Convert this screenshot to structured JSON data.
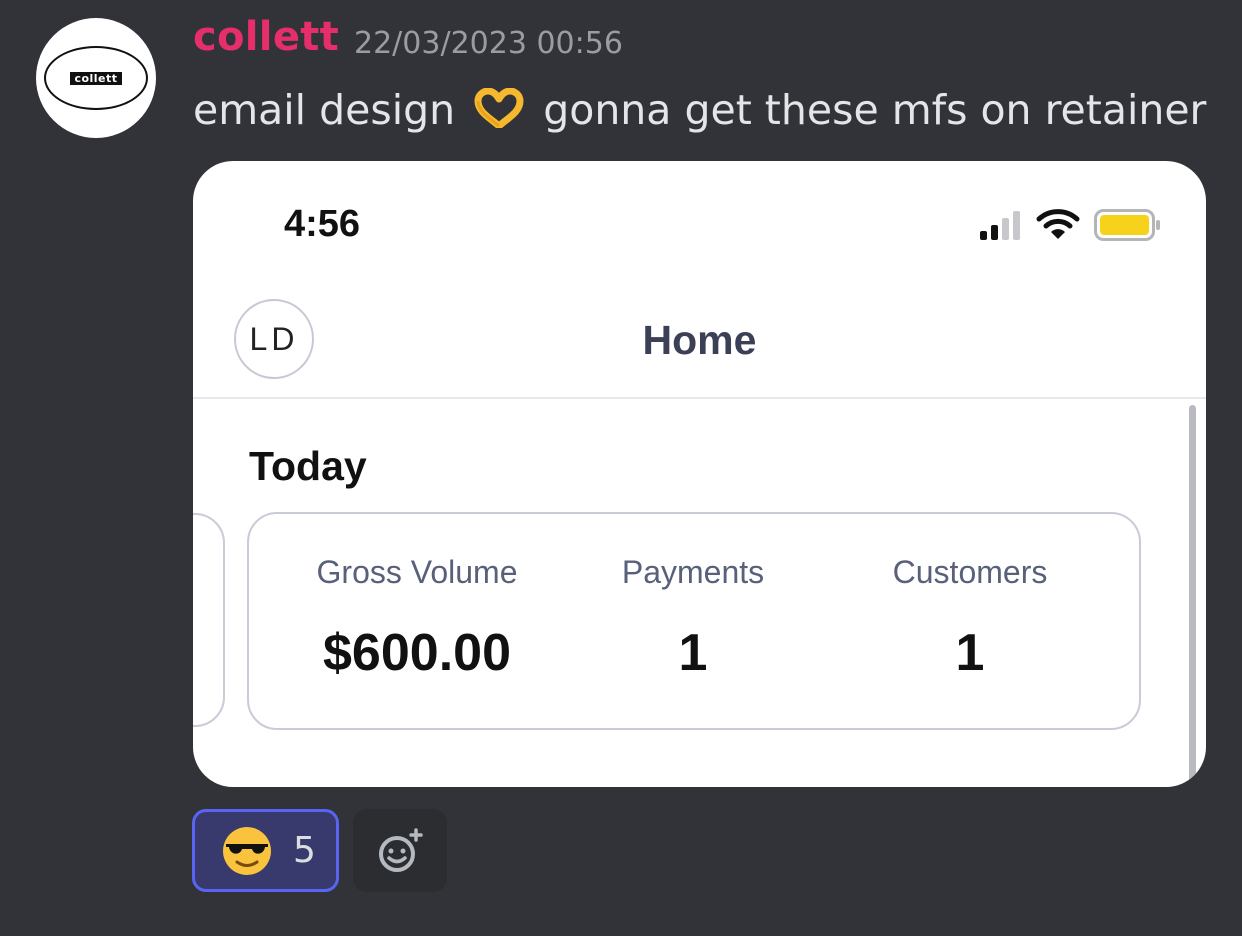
{
  "message": {
    "author": "collett",
    "avatar_text": "collett",
    "timestamp": "22/03/2023 00:56",
    "text_before": "email design ",
    "emoji": "heart-hands",
    "text_after": " gonna get these mfs on retainer",
    "author_color": "#e62e6b"
  },
  "attachment": {
    "status_time": "4:56",
    "profile_initials": "LD",
    "nav_title": "Home",
    "section_title": "Today",
    "stats": [
      {
        "label": "Gross Volume",
        "value": "$600.00"
      },
      {
        "label": "Payments",
        "value": "1"
      },
      {
        "label": "Customers",
        "value": "1"
      }
    ],
    "battery_color": "#f7d21b"
  },
  "reactions": [
    {
      "emoji": "smiling-face-with-sunglasses",
      "count": "5",
      "selected": true
    }
  ],
  "add_reaction": {
    "icon": "add-reaction-icon"
  },
  "colors": {
    "background": "#313338",
    "reaction_selected_border": "#5865f2"
  }
}
